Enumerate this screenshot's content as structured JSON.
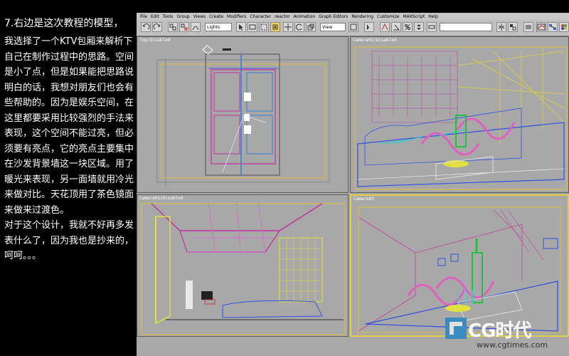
{
  "left_text": {
    "title": "7.右边是这次教程的模型，",
    "body": "我选择了一个KTV包厢来解析下自己在制作过程中的思路。空间是小了点，但是如果能把思路说明白的话，我想对朋友们也会有些帮助的。因为是娱乐空间，在这里都要采用比较强烈的手法来表现，这个空间不能过亮，但必须要有亮点，它的亮点主要集中在沙发背景墙这一块区域。用了暖光来表现，另一面墙就用冷光来做对比。天花顶用了茶色镜面来做来过渡色。\n对于这个设计，我就不好再多发表什么了，因为我也是抄来的，呵呵。。。"
  },
  "menu": [
    "File",
    "Edit",
    "Tools",
    "Group",
    "Views",
    "Create",
    "Modifiers",
    "Character",
    "reactor",
    "Animation",
    "Graph Editors",
    "Rendering",
    "Customize",
    "MAXScript",
    "Help"
  ],
  "toolbar": {
    "selection_filter": "Lights",
    "ref_coord": "View"
  },
  "viewports": {
    "top_left": "Top/Disabled",
    "top_right": "Camera02/Disabled",
    "bottom_left": "Camera01/Disabled",
    "bottom_right": "Camera03"
  },
  "watermark": {
    "brand": "CG时代",
    "url": "www.cgtimes.com"
  }
}
